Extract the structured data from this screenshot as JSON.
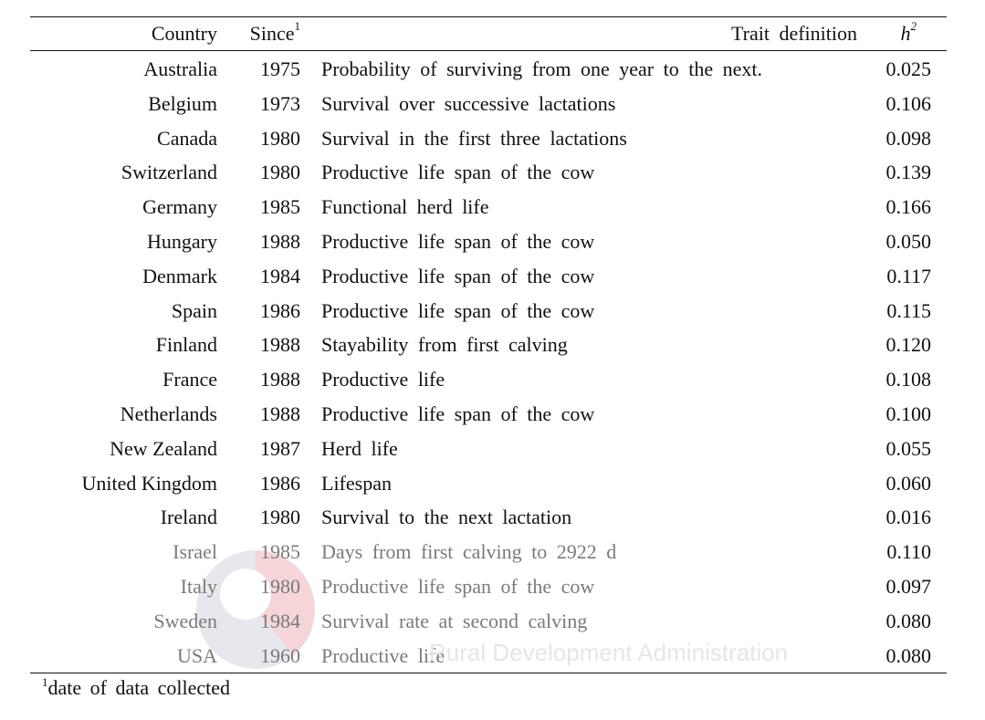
{
  "table": {
    "headers": {
      "country": "Country",
      "since": "Since",
      "since_sup": "1",
      "trait": "Trait definition",
      "h2_base": "h",
      "h2_sup": "2"
    },
    "rows": [
      {
        "country": "Australia",
        "since": "1975",
        "trait": "Probability of surviving from one year to the next.",
        "h2": "0.025"
      },
      {
        "country": "Belgium",
        "since": "1973",
        "trait": "Survival over successive lactations",
        "h2": "0.106"
      },
      {
        "country": "Canada",
        "since": "1980",
        "trait": "Survival in the first three lactations",
        "h2": "0.098"
      },
      {
        "country": "Switzerland",
        "since": "1980",
        "trait": "Productive life span of the cow",
        "h2": "0.139"
      },
      {
        "country": "Germany",
        "since": "1985",
        "trait": "Functional herd life",
        "h2": "0.166"
      },
      {
        "country": "Hungary",
        "since": "1988",
        "trait": "Productive life span of the cow",
        "h2": "0.050"
      },
      {
        "country": "Denmark",
        "since": "1984",
        "trait": "Productive life span of the cow",
        "h2": "0.117"
      },
      {
        "country": "Spain",
        "since": "1986",
        "trait": "Productive life span of the cow",
        "h2": "0.115"
      },
      {
        "country": "Finland",
        "since": "1988",
        "trait": "Stayability from first calving",
        "h2": "0.120"
      },
      {
        "country": "France",
        "since": "1988",
        "trait": "Productive life",
        "h2": "0.108"
      },
      {
        "country": "Netherlands",
        "since": "1988",
        "trait": "Productive life span of the cow",
        "h2": "0.100"
      },
      {
        "country": "New Zealand",
        "since": "1987",
        "trait": "Herd life",
        "h2": "0.055"
      },
      {
        "country": "United Kingdom",
        "since": "1986",
        "trait": "Lifespan",
        "h2": "0.060"
      },
      {
        "country": "Ireland",
        "since": "1980",
        "trait": "Survival to the next lactation",
        "h2": "0.016"
      },
      {
        "country": "Israel",
        "since": "1985",
        "trait": "Days from first calving to 2922 d",
        "h2": "0.110"
      },
      {
        "country": "Italy",
        "since": "1980",
        "trait": "Productive life span of the cow",
        "h2": "0.097"
      },
      {
        "country": "Sweden",
        "since": "1984",
        "trait": "Survival rate at second calving",
        "h2": "0.080"
      },
      {
        "country": "USA",
        "since": "1960",
        "trait": "Productive life",
        "h2": "0.080"
      }
    ]
  },
  "footnote": {
    "sup": "1",
    "text": "date of data collected"
  },
  "watermark": {
    "text": "Rural Development Administration"
  }
}
